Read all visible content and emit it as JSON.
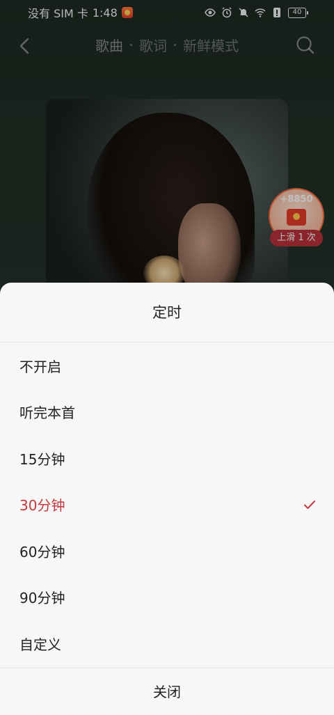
{
  "status_bar": {
    "carrier": "没有 SIM 卡",
    "time": "1:48",
    "battery": "40"
  },
  "nav": {
    "tabs": [
      "歌曲",
      "歌词",
      "新鲜模式"
    ]
  },
  "reward": {
    "amount": "+8850",
    "pill": "上滑 1 次"
  },
  "sheet": {
    "title": "定时",
    "options": [
      "不开启",
      "听完本首",
      "15分钟",
      "30分钟",
      "60分钟",
      "90分钟",
      "自定义"
    ],
    "selected_option": "30分钟",
    "close_label": "关闭"
  },
  "colors": {
    "accent": "#c23a3f",
    "background": "#1f2c24",
    "sheet": "#f7f7f7"
  },
  "icons": {
    "back": "chevron-left-icon",
    "search": "search-icon",
    "check": "checkmark-icon"
  }
}
